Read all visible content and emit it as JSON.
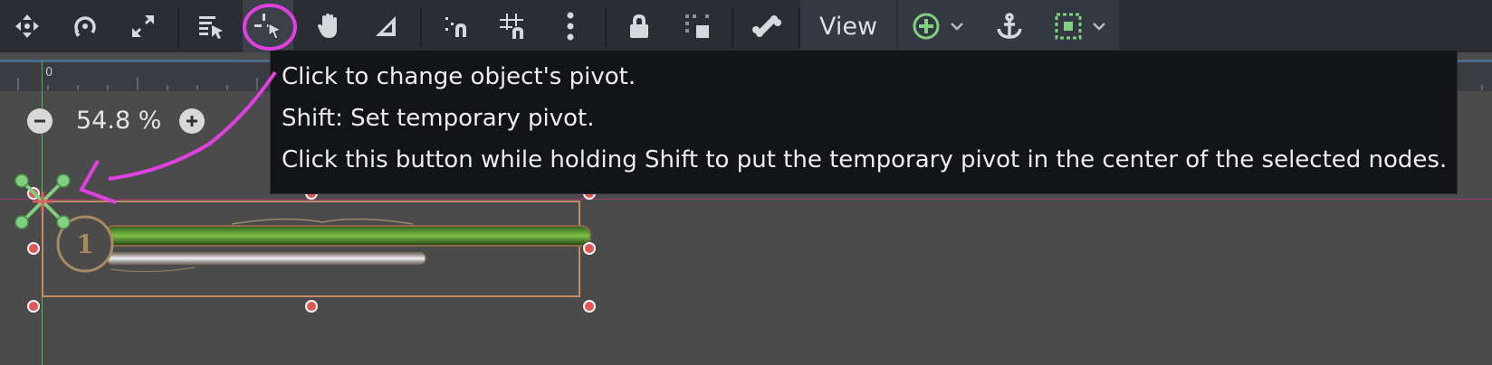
{
  "toolbar": {
    "buttons": [
      {
        "name": "select-mode",
        "icon": "move-arrows-icon"
      },
      {
        "name": "rotate-mode",
        "icon": "rotate-icon"
      },
      {
        "name": "scale-mode",
        "icon": "scale-arrows-icon"
      },
      {
        "name": "list-select",
        "icon": "list-select-icon"
      },
      {
        "name": "pivot-mode",
        "icon": "pivot-cursor-icon"
      },
      {
        "name": "pan-mode",
        "icon": "hand-icon"
      },
      {
        "name": "ruler-mode",
        "icon": "ruler-triangle-icon"
      },
      {
        "name": "smart-snap",
        "icon": "smart-snap-icon"
      },
      {
        "name": "grid-snap",
        "icon": "grid-snap-icon"
      },
      {
        "name": "snap-options",
        "icon": "kebab-menu-icon"
      },
      {
        "name": "lock",
        "icon": "lock-icon"
      },
      {
        "name": "group",
        "icon": "group-icon"
      },
      {
        "name": "skeleton",
        "icon": "bone-icon"
      },
      {
        "name": "add-node",
        "icon": "plus-circle-icon"
      },
      {
        "name": "anchor",
        "icon": "anchor-icon"
      },
      {
        "name": "container",
        "icon": "container-icon"
      }
    ],
    "view_label": "View"
  },
  "ruler": {
    "zero_label": "0"
  },
  "zoom": {
    "value": "54.8 %"
  },
  "tooltip": {
    "line1": "Click to change object's pivot.",
    "line2": "Shift: Set temporary pivot.",
    "line3": "Click this button while holding Shift to put the temporary pivot in the center of the selected nodes."
  },
  "canvas": {
    "level_badge": "1",
    "accent_color": "#5fbf5f",
    "selection_color": "#c88a6a",
    "annotation_color": "#e040e0"
  }
}
